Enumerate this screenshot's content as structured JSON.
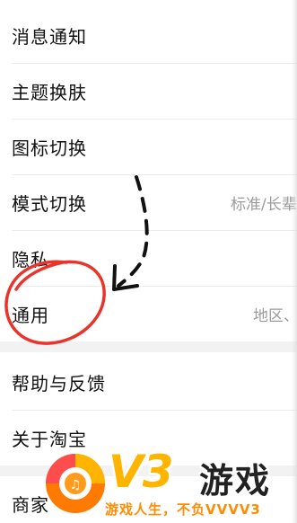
{
  "settings": {
    "items": [
      {
        "label": "消息通知",
        "value": ""
      },
      {
        "label": "主题换肤",
        "value": ""
      },
      {
        "label": "图标切换",
        "value": ""
      },
      {
        "label": "模式切换",
        "value": "标准/长辈✓"
      },
      {
        "label": "隐私",
        "value": ""
      },
      {
        "label": "通用",
        "value": "地区、"
      },
      {
        "label": "帮助与反馈",
        "value": ""
      },
      {
        "label": "关于淘宝",
        "value": ""
      },
      {
        "label": "商家",
        "value": ""
      }
    ]
  },
  "annotation": {
    "color": "#e8342a",
    "arrow_color": "#111111"
  },
  "watermark": {
    "logo_text": "V3",
    "title": "游戏",
    "slogan": "游戏人生，不负VVVV3",
    "accent_color": "#ffb400"
  }
}
